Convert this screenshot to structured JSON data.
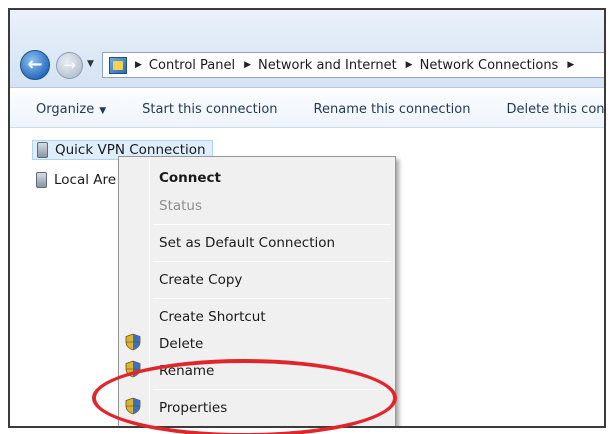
{
  "address_bar": {
    "breadcrumbs": [
      "Control Panel",
      "Network and Internet",
      "Network Connections"
    ],
    "icons": {
      "back": "back-arrow-icon",
      "forward": "forward-arrow-icon",
      "location": "control-panel-icon"
    }
  },
  "toolbar": {
    "organize_label": "Organize",
    "start_label": "Start this connection",
    "rename_label": "Rename this connection",
    "delete_label": "Delete this con"
  },
  "connections": [
    {
      "label": "Quick VPN Connection",
      "selected": true
    },
    {
      "label": "Local Are",
      "selected": false
    }
  ],
  "context_menu": {
    "items": [
      {
        "label": "Connect",
        "style": "bold",
        "shield": false
      },
      {
        "label": "Status",
        "style": "disabled",
        "shield": false
      },
      {
        "label": "Set as Default Connection",
        "style": "normal",
        "shield": false
      },
      {
        "label": "Create Copy",
        "style": "normal",
        "shield": false
      },
      {
        "label": "Create Shortcut",
        "style": "normal",
        "shield": false
      },
      {
        "label": "Delete",
        "style": "normal",
        "shield": true
      },
      {
        "label": "Rename",
        "style": "normal",
        "shield": true
      },
      {
        "label": "Properties",
        "style": "normal",
        "shield": true
      }
    ],
    "highlighted_item": "Properties",
    "highlight_color": "#e1252a"
  }
}
